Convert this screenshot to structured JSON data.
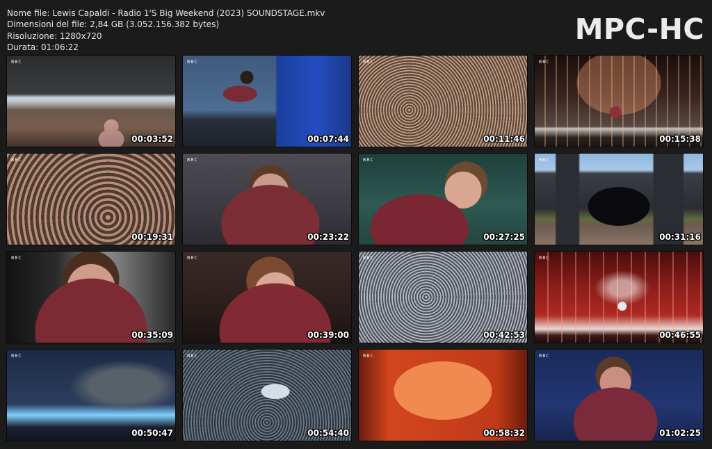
{
  "info": {
    "filename": "Nome file: Lewis Capaldi - Radio 1'S Big Weekend (2023) SOUNDSTAGE.mkv",
    "filesize": "Dimensioni del file: 2,84 GB (3.052.156.382 bytes)",
    "resolution": "Risoluzione: 1280x720",
    "duration": "Durata: 01:06:22"
  },
  "brand": "MPC-HC",
  "channel_logo": "BBC",
  "thumbnails": [
    {
      "time": "00:03:52",
      "scene": "crowd-stage-wide"
    },
    {
      "time": "00:07:44",
      "scene": "singer-keyboard-blue"
    },
    {
      "time": "00:11:46",
      "scene": "crowd-wide"
    },
    {
      "time": "00:15:38",
      "scene": "stage-lights-dark"
    },
    {
      "time": "00:19:31",
      "scene": "crowd-close"
    },
    {
      "time": "00:23:22",
      "scene": "singer-guitar-closeup"
    },
    {
      "time": "00:27:25",
      "scene": "singer-guitar-mic"
    },
    {
      "time": "00:31:16",
      "scene": "stage-outdoor-daylight"
    },
    {
      "time": "00:35:09",
      "scene": "singer-mic-closeup"
    },
    {
      "time": "00:39:00",
      "scene": "singer-hand-on-head"
    },
    {
      "time": "00:42:53",
      "scene": "crowd-evening"
    },
    {
      "time": "00:46:55",
      "scene": "stage-red-lights"
    },
    {
      "time": "00:50:47",
      "scene": "stage-screen-blue"
    },
    {
      "time": "00:54:40",
      "scene": "aerial-park-crowd"
    },
    {
      "time": "00:58:32",
      "scene": "stage-orange-screen"
    },
    {
      "time": "01:02:25",
      "scene": "singer-mic-purple"
    }
  ]
}
